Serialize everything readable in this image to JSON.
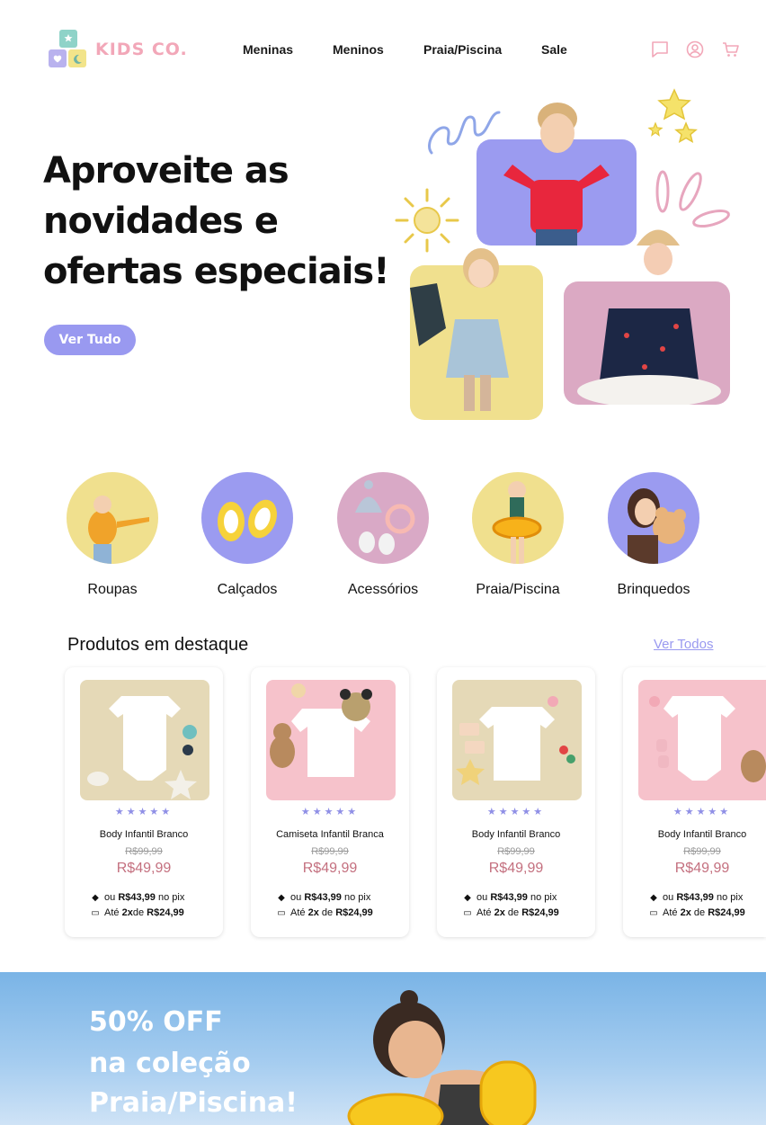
{
  "brand": {
    "name": "KIDS CO."
  },
  "nav": [
    {
      "label": "Meninas"
    },
    {
      "label": "Meninos"
    },
    {
      "label": "Praia/Piscina"
    },
    {
      "label": "Sale"
    }
  ],
  "header_icons": [
    "chat-icon",
    "user-icon",
    "cart-icon"
  ],
  "hero": {
    "title_lines": [
      "Aproveite as",
      "novidades e",
      "ofertas especiais!"
    ],
    "button_label": "Ver Tudo"
  },
  "categories": [
    {
      "label": "Roupas",
      "color": "#f0e08e"
    },
    {
      "label": "Calçados",
      "color": "#9b9bf0"
    },
    {
      "label": "Acessórios",
      "color": "#d9a9c6"
    },
    {
      "label": "Praia/Piscina",
      "color": "#f0e08e"
    },
    {
      "label": "Brinquedos",
      "color": "#9b9bf0"
    }
  ],
  "products_section": {
    "title": "Produtos em destaque",
    "see_all": "Ver Todos"
  },
  "products": [
    {
      "name": "Body Infantil Branco",
      "stars": "★★★★★",
      "old_price": "R$99,99",
      "price": "R$49,99",
      "pix_prefix": "ou",
      "pix_value": "R$43,99",
      "pix_suffix": "no pix",
      "inst_prefix": "Até",
      "inst_count": "2x",
      "inst_mid": "de",
      "inst_value": "R$24,99",
      "bg": "#e5d9b7"
    },
    {
      "name": "Camiseta Infantil Branca",
      "stars": "★★★★★",
      "old_price": "R$99,99",
      "price": "R$49,99",
      "pix_prefix": "ou",
      "pix_value": "R$43,99",
      "pix_suffix": "no pix",
      "inst_prefix": "Até",
      "inst_count": "2x",
      "inst_mid": "de",
      "inst_value": "R$24,99",
      "bg": "#f6c2cb"
    },
    {
      "name": "Body Infantil Branco",
      "stars": "★★★★★",
      "old_price": "R$99,99",
      "price": "R$49,99",
      "pix_prefix": "ou",
      "pix_value": "R$43,99",
      "pix_suffix": "no pix",
      "inst_prefix": "Até",
      "inst_count": "2x",
      "inst_mid": "de",
      "inst_value": "R$24,99",
      "bg": "#e5d9b7"
    },
    {
      "name": "Body Infantil Branco",
      "stars": "★★★★★",
      "old_price": "R$99,99",
      "price": "R$49,99",
      "pix_prefix": "ou",
      "pix_value": "R$43,99",
      "pix_suffix": "no pix",
      "inst_prefix": "Até",
      "inst_count": "2x",
      "inst_mid": "de",
      "inst_value": "R$24,99",
      "bg": "#f6c2cb"
    }
  ],
  "promo": {
    "lines": [
      "50% OFF",
      "na coleção",
      "Praia/Piscina!"
    ]
  },
  "colors": {
    "accent": "#9999f0",
    "brand_pink": "#f2a7b8",
    "price": "#c4707f",
    "yellow": "#f0e08e",
    "lavender": "#9b9bf0",
    "pink": "#d9a9c6"
  }
}
